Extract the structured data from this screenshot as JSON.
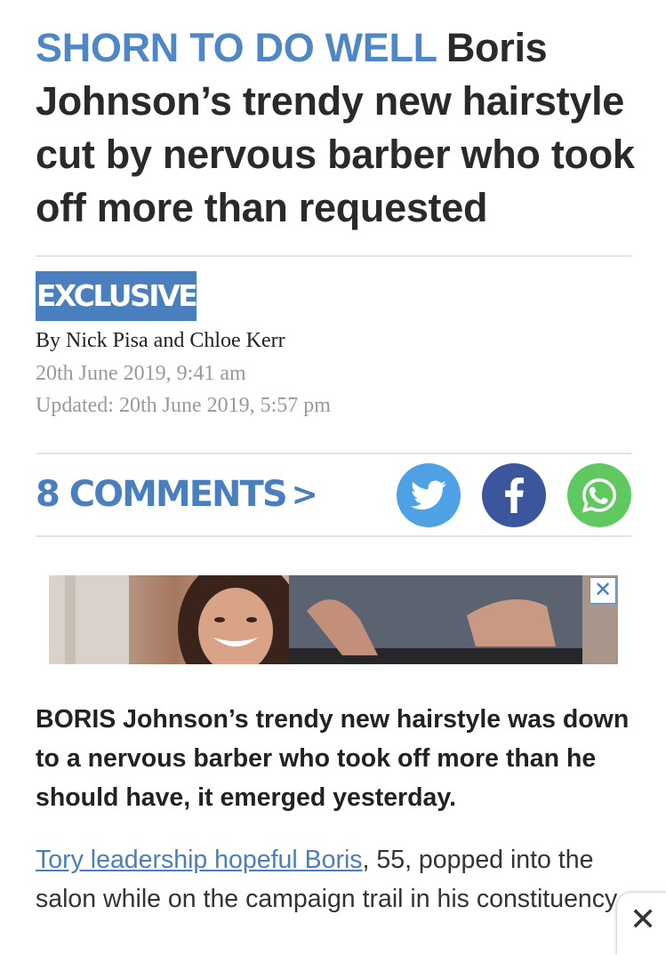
{
  "article": {
    "kicker": "SHORN TO DO WELL",
    "headline": "Boris Johnson’s trendy new hairstyle cut by nervous barber who took off more than requested",
    "badge": "EXCLUSIVE",
    "byline": "By Nick Pisa and Chloe Kerr",
    "date": "20th June 2019, 9:41 am",
    "updated": "Updated: 20th June 2019, 5:57 pm",
    "comments_label": "8 COMMENTS",
    "comments_chevron": ">",
    "lede": "BORIS Johnson’s trendy new hairstyle was down to a nervous barber who took off more than he should have, it emerged yesterday.",
    "para1_link": "Tory leadership hopeful Boris",
    "para1_text": ", 55, popped into the salon while on the campaign trail in his constituency."
  },
  "share": {
    "icons": [
      "twitter-icon",
      "facebook-icon",
      "whatsapp-icon"
    ],
    "colors": {
      "twitter": "#4fa1e6",
      "facebook": "#3b569d",
      "whatsapp": "#5fc95f"
    }
  },
  "ad": {
    "close_glyph": "✕"
  },
  "overlay": {
    "close_glyph": "✕"
  },
  "theme": {
    "accent": "#4a7fbf",
    "kicker": "#4f86c6"
  }
}
